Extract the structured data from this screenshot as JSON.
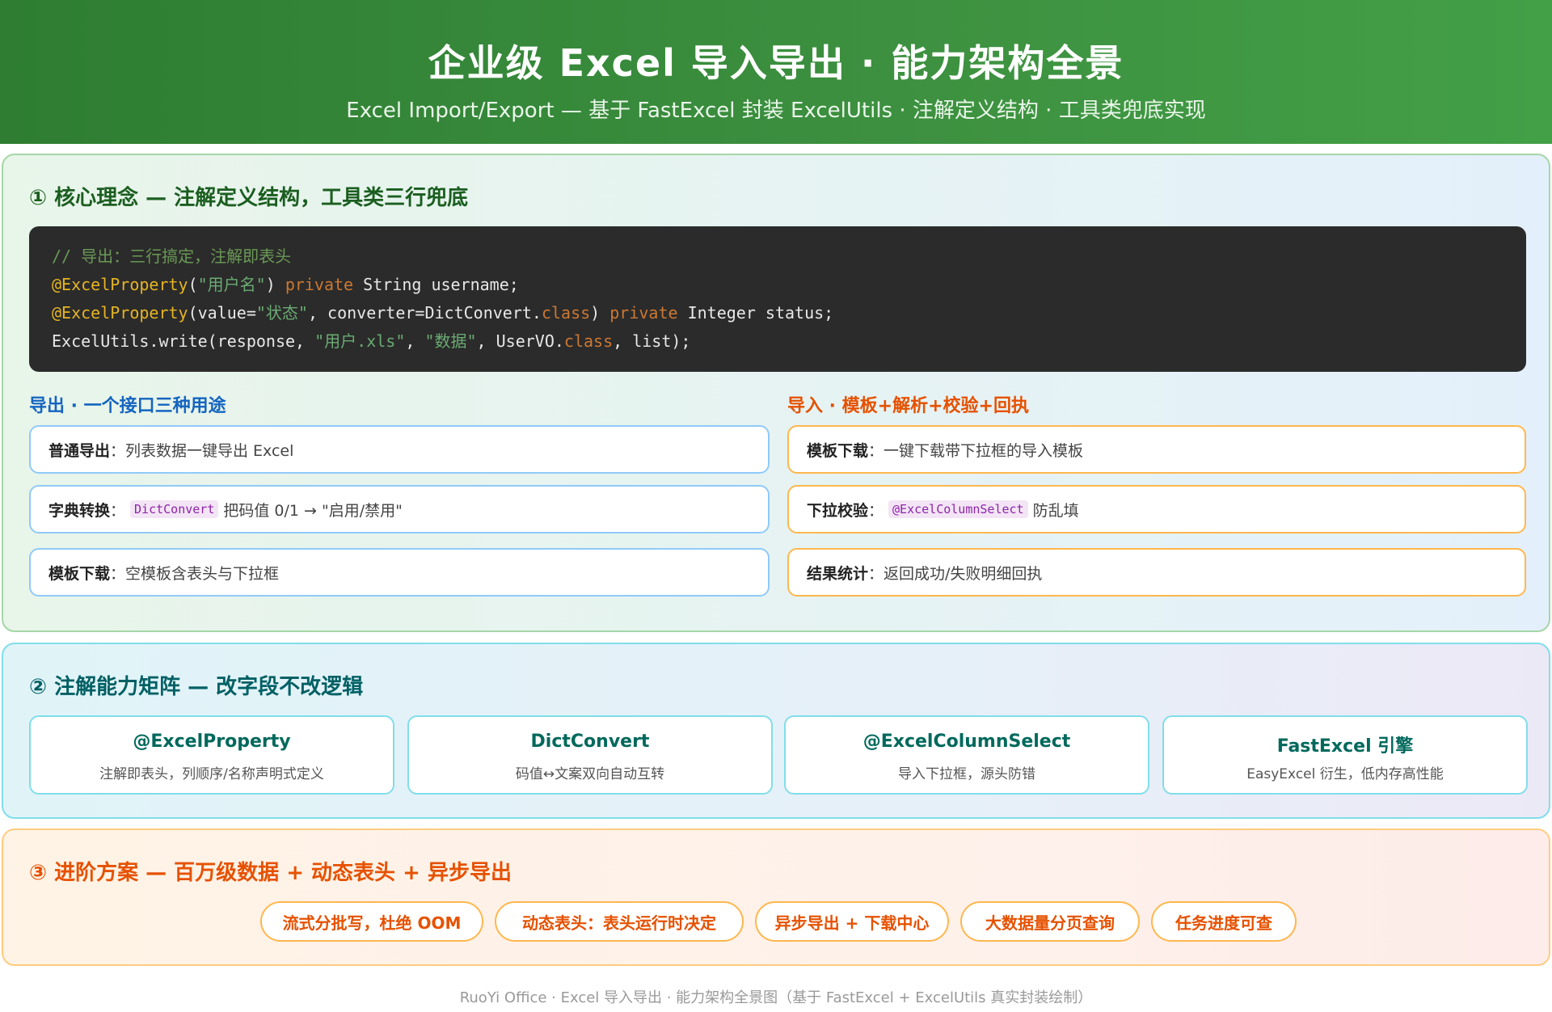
{
  "header": {
    "title": "企业级 Excel 导入导出 · 能力架构全景",
    "subtitle": "Excel Import/Export — 基于 FastExcel 封装 ExcelUtils · 注解定义结构 · 工具类兜底实现"
  },
  "section1": {
    "title": "① 核心理念 — 注解定义结构，工具类三行兜底",
    "code": {
      "line1": "// 导出：三行搞定，注解即表头",
      "line2": {
        "anno": "@ExcelProperty",
        "p1": "(",
        "str": "\"用户名\"",
        "p2": ") ",
        "kw": "private",
        "rest": " String username;"
      },
      "line3": {
        "anno": "@ExcelProperty",
        "p1": "(value=",
        "str": "\"状态\"",
        "p2": ", converter=DictConvert.",
        "kw1": "class",
        "p3": ") ",
        "kw2": "private",
        "rest": " Integer status;"
      },
      "line4": {
        "p1": "ExcelUtils.write(response, ",
        "str1": "\"用户.xls\"",
        "p2": ", ",
        "str2": "\"数据\"",
        "p3": ", UserVO.",
        "kw": "class",
        "rest": ", list);"
      }
    },
    "export": {
      "title": "导出 · 一个接口三种用途",
      "items": [
        {
          "key": "普通导出",
          "text": "：列表数据一键导出 Excel"
        },
        {
          "key": "字典转换",
          "pre": "：",
          "tag": "DictConvert",
          "text": "把码值 0/1 → \"启用/禁用\""
        },
        {
          "key": "模板下载",
          "text": "：空模板含表头与下拉框"
        }
      ]
    },
    "import": {
      "title": "导入 · 模板+解析+校验+回执",
      "items": [
        {
          "key": "模板下载",
          "text": "：一键下载带下拉框的导入模板"
        },
        {
          "key": "下拉校验",
          "pre": "：",
          "tag": "@ExcelColumnSelect",
          "text": "防乱填"
        },
        {
          "key": "结果统计",
          "text": "：返回成功/失败明细回执"
        }
      ]
    }
  },
  "section2": {
    "title": "② 注解能力矩阵 — 改字段不改逻辑",
    "cards": [
      {
        "title": "@ExcelProperty",
        "desc": "注解即表头，列顺序/名称声明式定义"
      },
      {
        "title": "DictConvert",
        "desc": "码值↔文案双向自动互转"
      },
      {
        "title": "@ExcelColumnSelect",
        "desc": "导入下拉框，源头防错"
      },
      {
        "title": "FastExcel 引擎",
        "desc": "EasyExcel 衍生，低内存高性能"
      }
    ]
  },
  "section3": {
    "title": "③ 进阶方案 — 百万级数据 + 动态表头 + 异步导出",
    "pills": [
      "流式分批写，杜绝 OOM",
      "动态表头：表头运行时决定",
      "异步导出 + 下载中心",
      "大数据量分页查询",
      "任务进度可查"
    ]
  },
  "footer": "RuoYi Office · Excel 导入导出 · 能力架构全景图（基于 FastExcel + ExcelUtils 真实封装绘制）"
}
